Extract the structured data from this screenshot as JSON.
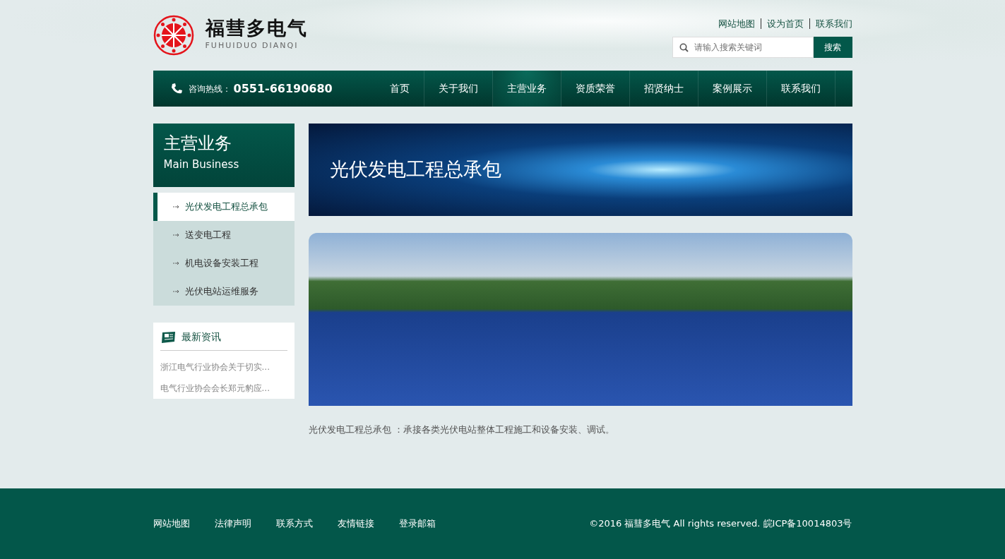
{
  "header": {
    "logo_name": "福彗多电气",
    "logo_pinyin": "FUHUIDUO DIANQI",
    "top_links": [
      "网站地图",
      "设为首页",
      "联系我们"
    ],
    "search": {
      "placeholder": "请输入搜索关键词",
      "button": "搜索"
    }
  },
  "navbar": {
    "hotline_label": "咨询热线：",
    "hotline_number": "0551-66190680",
    "items": [
      {
        "label": "首页",
        "selected": false
      },
      {
        "label": "关于我们",
        "selected": false
      },
      {
        "label": "主营业务",
        "selected": true
      },
      {
        "label": "资质荣誉",
        "selected": false
      },
      {
        "label": "招贤纳士",
        "selected": false
      },
      {
        "label": "案例展示",
        "selected": false
      },
      {
        "label": "联系我们",
        "selected": false
      }
    ]
  },
  "sidebar": {
    "title": "主营业务",
    "subtitle": "Main Business",
    "items": [
      {
        "label": "光伏发电工程总承包",
        "selected": true
      },
      {
        "label": "送变电工程",
        "selected": false
      },
      {
        "label": "机电设备安装工程",
        "selected": false
      },
      {
        "label": "光伏电站运维服务",
        "selected": false
      }
    ],
    "news": {
      "title": "最新资讯",
      "items": [
        "浙江电气行业协会关于切实...",
        "电气行业协会会长郑元豹应..."
      ]
    }
  },
  "content": {
    "banner_title": "光伏发电工程总承包",
    "description": "光伏发电工程总承包 ：承接各类光伏电站整体工程施工和设备安装、调试。"
  },
  "footer": {
    "links": [
      "网站地图",
      "法律声明",
      "联系方式",
      "友情链接",
      "登录邮箱"
    ],
    "copyright": "©2016 福彗多电气 All rights reserved. 皖ICP备10014803号"
  }
}
